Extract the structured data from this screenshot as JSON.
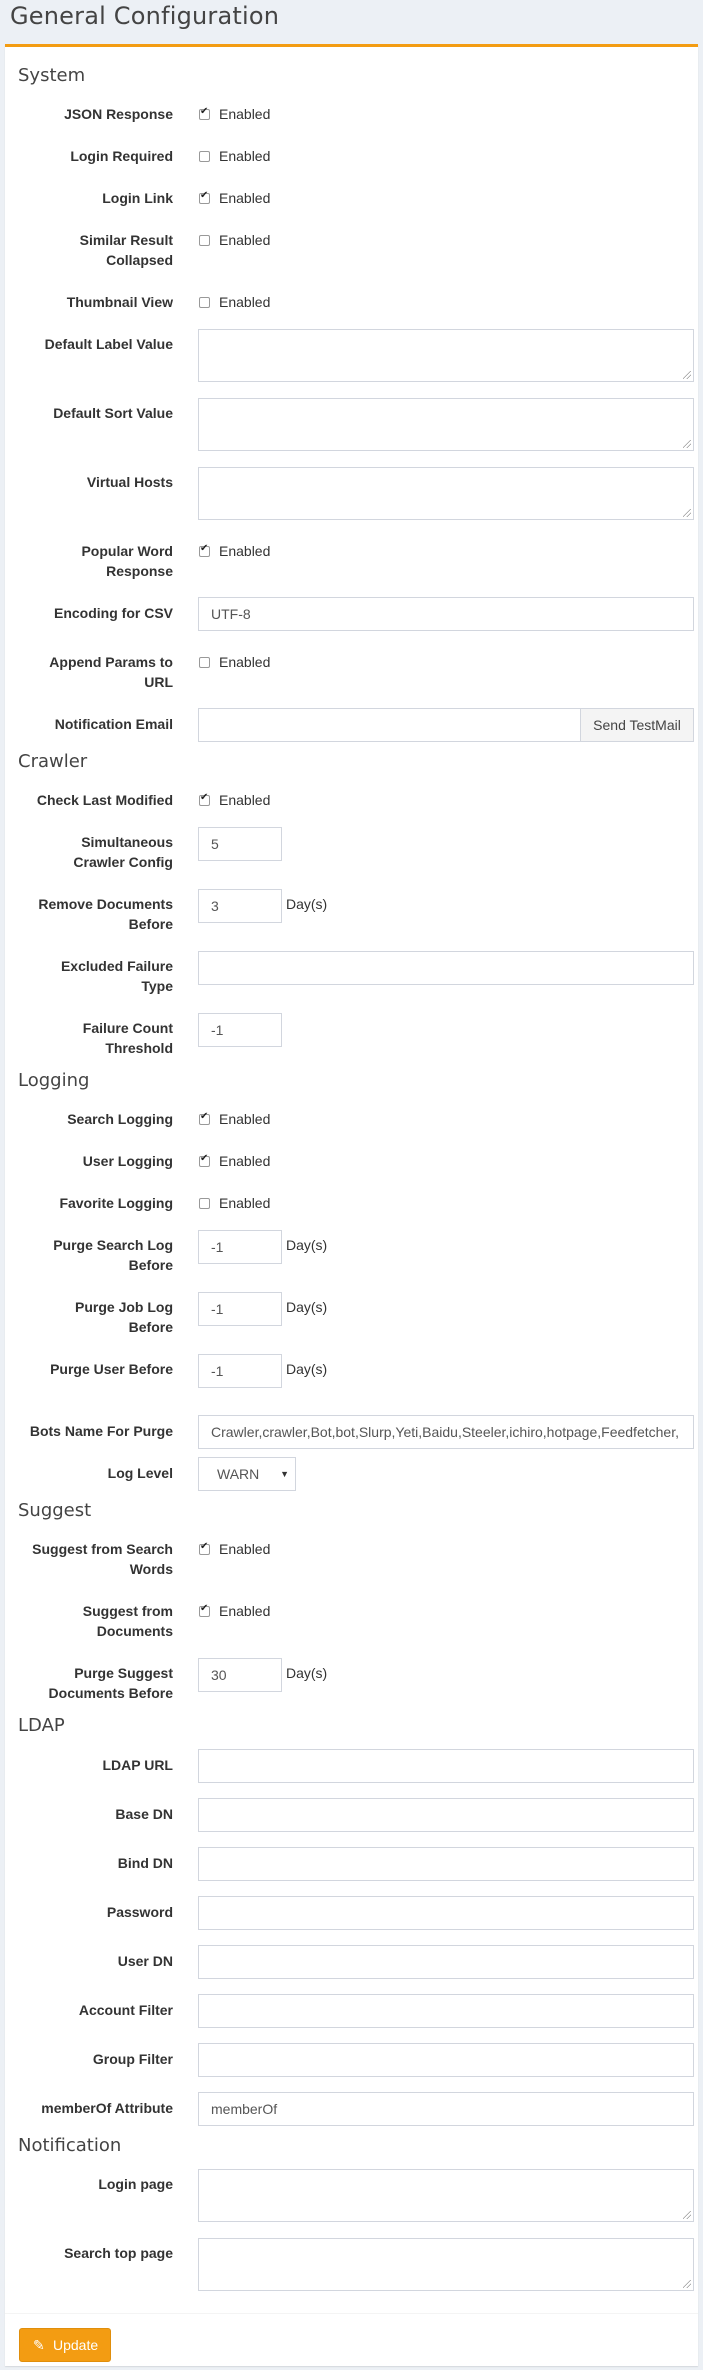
{
  "page_title": "General Configuration",
  "enabled_text": "Enabled",
  "days_unit": "Day(s)",
  "accent_color": "#f39c12",
  "sections": {
    "system": "System",
    "crawler": "Crawler",
    "logging": "Logging",
    "suggest": "Suggest",
    "ldap": "LDAP",
    "notification": "Notification"
  },
  "system": {
    "json_response": {
      "label": "JSON Response",
      "checked": true
    },
    "login_required": {
      "label": "Login Required",
      "checked": false
    },
    "login_link": {
      "label": "Login Link",
      "checked": true
    },
    "similar_result_collapsed": {
      "label_line1": "Similar Result",
      "label_line2": "Collapsed",
      "checked": false
    },
    "thumbnail_view": {
      "label": "Thumbnail View",
      "checked": false
    },
    "default_label_value": {
      "label": "Default Label Value",
      "value": ""
    },
    "default_sort_value": {
      "label": "Default Sort Value",
      "value": ""
    },
    "virtual_hosts": {
      "label": "Virtual Hosts",
      "value": ""
    },
    "popular_word_response": {
      "label_line1": "Popular Word",
      "label_line2": "Response",
      "checked": true
    },
    "encoding_for_csv": {
      "label": "Encoding for CSV",
      "value": "UTF-8"
    },
    "append_params": {
      "label_line1": "Append Params to",
      "label_line2": "URL",
      "checked": false
    },
    "notification_email": {
      "label": "Notification Email",
      "value": "",
      "button": "Send TestMail"
    }
  },
  "crawler": {
    "check_last_modified": {
      "label": "Check Last Modified",
      "checked": true
    },
    "simultaneous_crawler_config": {
      "label_line1": "Simultaneous",
      "label_line2": "Crawler Config",
      "value": "5"
    },
    "remove_documents_before": {
      "label_line1": "Remove Documents",
      "label_line2": "Before",
      "value": "3"
    },
    "excluded_failure_type": {
      "label_line1": "Excluded Failure",
      "label_line2": "Type",
      "value": ""
    },
    "failure_count_threshold": {
      "label_line1": "Failure Count",
      "label_line2": "Threshold",
      "value": "-1"
    }
  },
  "logging": {
    "search_logging": {
      "label": "Search Logging",
      "checked": true
    },
    "user_logging": {
      "label": "User Logging",
      "checked": true
    },
    "favorite_logging": {
      "label": "Favorite Logging",
      "checked": false
    },
    "purge_search_log_before": {
      "label_line1": "Purge Search Log",
      "label_line2": "Before",
      "value": "-1"
    },
    "purge_job_log_before": {
      "label_line1": "Purge Job Log",
      "label_line2": "Before",
      "value": "-1"
    },
    "purge_user_before": {
      "label": "Purge User Before",
      "value": "-1"
    },
    "bots_name_for_purge": {
      "label": "Bots Name For Purge",
      "value": "Crawler,crawler,Bot,bot,Slurp,Yeti,Baidu,Steeler,ichiro,hotpage,Feedfetcher,"
    },
    "log_level": {
      "label": "Log Level",
      "value": "WARN"
    }
  },
  "suggest": {
    "suggest_from_search_words": {
      "label_line1": "Suggest from Search",
      "label_line2": "Words",
      "checked": true
    },
    "suggest_from_documents": {
      "label_line1": "Suggest from",
      "label_line2": "Documents",
      "checked": true
    },
    "purge_suggest_documents_before": {
      "label_line1": "Purge Suggest",
      "label_line2": "Documents Before",
      "value": "30"
    }
  },
  "ldap": {
    "ldap_url": {
      "label": "LDAP URL",
      "value": ""
    },
    "base_dn": {
      "label": "Base DN",
      "value": ""
    },
    "bind_dn": {
      "label": "Bind DN",
      "value": ""
    },
    "password": {
      "label": "Password",
      "value": ""
    },
    "user_dn": {
      "label": "User DN",
      "value": ""
    },
    "account_filter": {
      "label": "Account Filter",
      "value": ""
    },
    "group_filter": {
      "label": "Group Filter",
      "value": ""
    },
    "member_of_attribute": {
      "label": "memberOf Attribute",
      "value": "memberOf"
    }
  },
  "notification": {
    "login_page": {
      "label": "Login page",
      "value": ""
    },
    "search_top_page": {
      "label": "Search top page",
      "value": ""
    }
  },
  "update_button": "Update"
}
